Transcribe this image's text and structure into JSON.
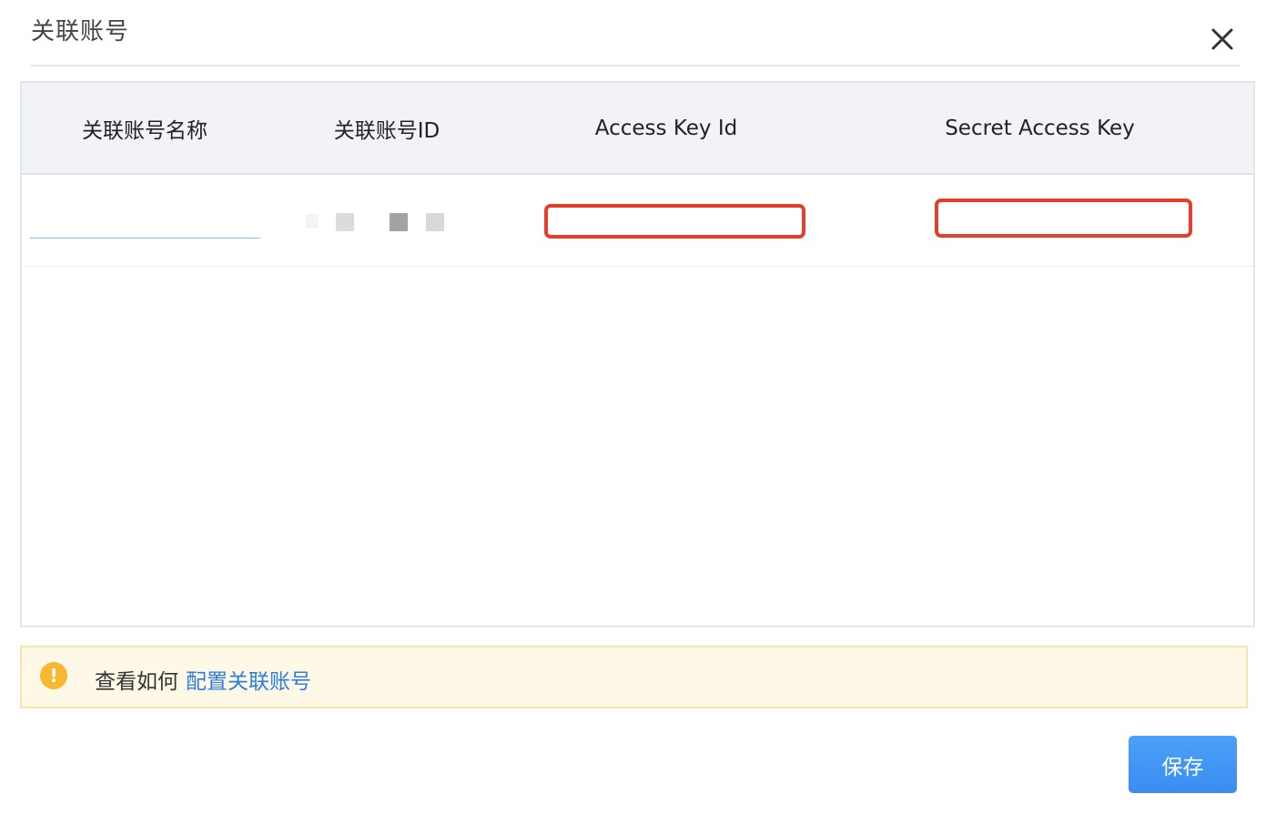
{
  "dialog": {
    "title": "关联账号"
  },
  "table": {
    "columns": [
      "关联账号名称",
      "关联账号ID",
      "Access Key Id",
      "Secret Access Key"
    ],
    "rows": [
      {
        "account_name": "",
        "account_id": "",
        "access_key_id": "",
        "secret_access_key": ""
      }
    ]
  },
  "notice": {
    "prefix": "查看如何",
    "link": "配置关联账号"
  },
  "footer": {
    "save_label": "保存"
  },
  "colors": {
    "primary": "#3a8df1",
    "link": "#2f7de0",
    "highlight_border": "#e2402b",
    "warning": "#f7b731",
    "notice_bg": "#fef9e7"
  }
}
